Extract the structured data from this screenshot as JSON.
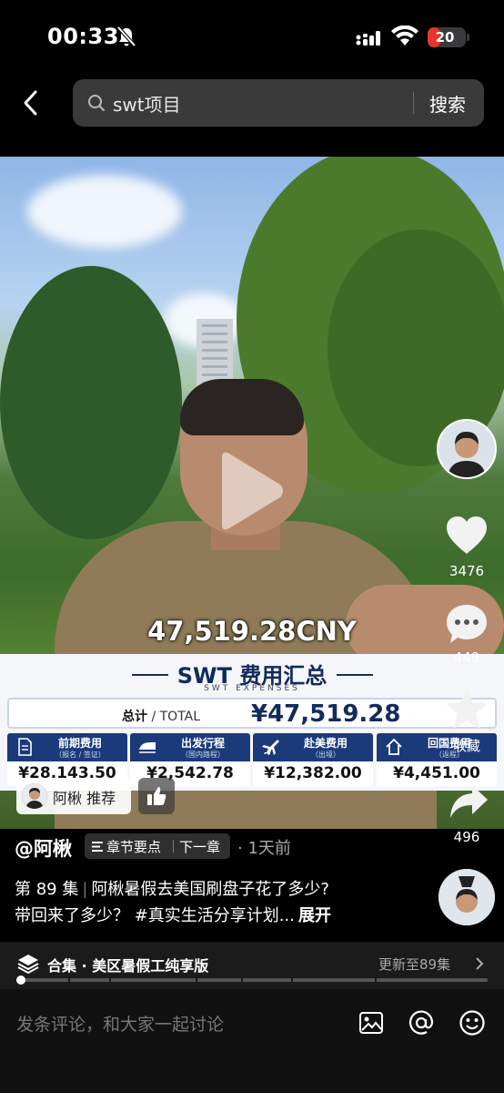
{
  "status_bar": {
    "time": "00:33",
    "battery_level": "20",
    "battery_fraction": 0.2,
    "battery_color": "#e5352d"
  },
  "header": {
    "search_query": "swt项目",
    "search_button": "搜索"
  },
  "video": {
    "overlay_amount": "47,519.28CNY",
    "card": {
      "title": "SWT 费用汇总",
      "subtitle": "SWT EXPENSES",
      "total_label_cn": "总计",
      "total_label_en": "/ TOTAL",
      "total_value": "¥47,519.28",
      "categories": [
        {
          "name": "前期费用",
          "note": "（报名 / 签证）",
          "value": "¥28,143.50",
          "icon": "document-icon"
        },
        {
          "name": "出发行程",
          "note": "（国内路程）",
          "value": "¥2,542.78",
          "icon": "train-icon"
        },
        {
          "name": "赴美费用",
          "note": "（出境）",
          "value": "¥12,382.00",
          "icon": "airplane-icon"
        },
        {
          "name": "回国费用",
          "note": "（返程）",
          "value": "¥4,451.00",
          "icon": "home-icon"
        }
      ]
    },
    "recommend_chip": "阿楸 推荐"
  },
  "actions": {
    "likes": "3476",
    "comments": "449",
    "favorites": "收藏",
    "shares": "496"
  },
  "info": {
    "author": "@阿楸",
    "chapter_points": "章节要点",
    "next_chapter": "下一章",
    "time_ago": "· 1天前",
    "episode": "第 89 集",
    "title_line1": "阿楸暑假去美国刷盘子花了多少?",
    "title_line2": "带回来了多少？ #真实生活分享计划...",
    "expand": "展开"
  },
  "collection": {
    "title": "合集 · 美区暑假工纯享版",
    "update": "更新至89集",
    "progress": 0.01
  },
  "comment_bar": {
    "placeholder": "发条评论，和大家一起讨论"
  }
}
